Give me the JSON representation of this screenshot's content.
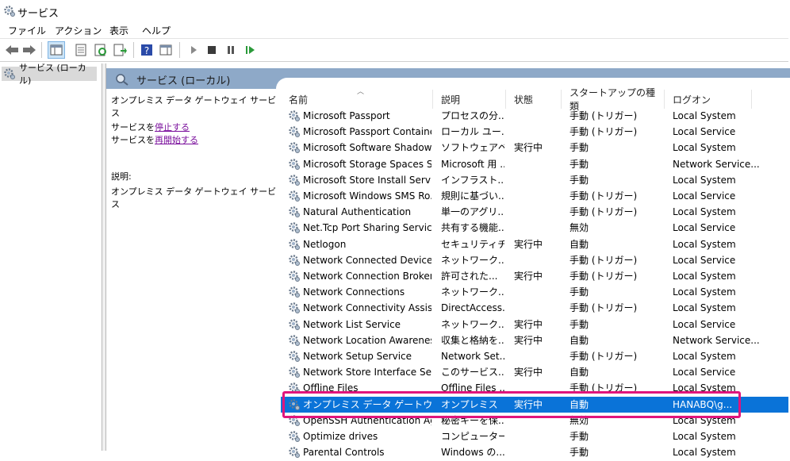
{
  "window": {
    "title": "サービス",
    "icon": "services-gear-icon"
  },
  "menu": [
    "ファイル",
    "アクション",
    "表示",
    "ヘルプ"
  ],
  "toolbar": {
    "buttons": [
      "back-icon",
      "forward-icon",
      "show-hide-console-tree-icon",
      "properties-icon",
      "refresh-icon",
      "export-list-icon",
      "help-icon",
      "show-action-pane-icon",
      "start-service-icon",
      "stop-service-icon",
      "pause-service-icon",
      "resume-service-icon"
    ]
  },
  "tree": {
    "item": "サービス (ローカル)"
  },
  "content": {
    "header": "サービス (ローカル)",
    "selected_name": "オンプレミス データ ゲートウェイ サービス",
    "stop_prefix": "サービスを",
    "stop_link": "停止する",
    "restart_prefix": "サービスを",
    "restart_link": "再開始する",
    "desc_label": "説明:",
    "desc_text": "オンプレミス データ ゲートウェイ サービス"
  },
  "columns": [
    "名前",
    "説明",
    "状態",
    "スタートアップの種類",
    "ログオン"
  ],
  "rows": [
    {
      "name": "Microsoft Passport",
      "desc": "プロセスの分...",
      "status": "",
      "startup": "手動 (トリガー)",
      "logon": "Local System"
    },
    {
      "name": "Microsoft Passport Container",
      "desc": "ローカル ユー...",
      "status": "",
      "startup": "手動 (トリガー)",
      "logon": "Local Service"
    },
    {
      "name": "Microsoft Software Shadow...",
      "desc": "ソフトウェアベ...",
      "status": "実行中",
      "startup": "手動",
      "logon": "Local System"
    },
    {
      "name": "Microsoft Storage Spaces SMP",
      "desc": "Microsoft 用 ...",
      "status": "",
      "startup": "手動",
      "logon": "Network Service..."
    },
    {
      "name": "Microsoft Store Install Service",
      "desc": "インフラスト...",
      "status": "",
      "startup": "手動",
      "logon": "Local System"
    },
    {
      "name": "Microsoft Windows SMS Ro...",
      "desc": "規則に基づい...",
      "status": "",
      "startup": "手動 (トリガー)",
      "logon": "Local Service"
    },
    {
      "name": "Natural Authentication",
      "desc": "単一のアグリ...",
      "status": "",
      "startup": "手動 (トリガー)",
      "logon": "Local System"
    },
    {
      "name": "Net.Tcp Port Sharing Service",
      "desc": "共有する機能...",
      "status": "",
      "startup": "無効",
      "logon": "Local Service"
    },
    {
      "name": "Netlogon",
      "desc": "セキュリティチ...",
      "status": "実行中",
      "startup": "自動",
      "logon": "Local System"
    },
    {
      "name": "Network Connected Devices...",
      "desc": "ネットワーク...",
      "status": "",
      "startup": "手動 (トリガー)",
      "logon": "Local Service"
    },
    {
      "name": "Network Connection Broker",
      "desc": "許可された...",
      "status": "実行中",
      "startup": "手動 (トリガー)",
      "logon": "Local System"
    },
    {
      "name": "Network Connections",
      "desc": "ネットワーク...",
      "status": "",
      "startup": "手動",
      "logon": "Local System"
    },
    {
      "name": "Network Connectivity Assist...",
      "desc": "DirectAccess...",
      "status": "",
      "startup": "手動 (トリガー)",
      "logon": "Local System"
    },
    {
      "name": "Network List Service",
      "desc": "ネットワーク...",
      "status": "実行中",
      "startup": "手動",
      "logon": "Local Service"
    },
    {
      "name": "Network Location Awareness",
      "desc": "収集と格納を...",
      "status": "実行中",
      "startup": "自動",
      "logon": "Network Service..."
    },
    {
      "name": "Network Setup Service",
      "desc": "Network Set...",
      "status": "",
      "startup": "手動 (トリガー)",
      "logon": "Local System"
    },
    {
      "name": "Network Store Interface Serv...",
      "desc": "このサービス...",
      "status": "実行中",
      "startup": "自動",
      "logon": "Local Service"
    },
    {
      "name": "Offline Files",
      "desc": "Offline Files ...",
      "status": "",
      "startup": "手動 (トリガー)",
      "logon": "Local System"
    },
    {
      "name": "オンプレミス データ ゲートウェ...",
      "desc": "オンプレミス",
      "status": "実行中",
      "startup": "自動",
      "logon": "HANABQ\\g...",
      "selected": true
    },
    {
      "name": "OpenSSH Authentication Age...",
      "desc": "秘密キーを保...",
      "status": "",
      "startup": "無効",
      "logon": "Local System"
    },
    {
      "name": "Optimize drives",
      "desc": "コンピューター...",
      "status": "",
      "startup": "手動",
      "logon": "Local System"
    },
    {
      "name": "Parental Controls",
      "desc": "Windows の...",
      "status": "",
      "startup": "手動",
      "logon": "Local System"
    }
  ],
  "colors": {
    "selection": "#0a73d8",
    "header_band": "#8ea9c8",
    "highlight_border": "#e0157c",
    "link": "#7a0f9c"
  }
}
